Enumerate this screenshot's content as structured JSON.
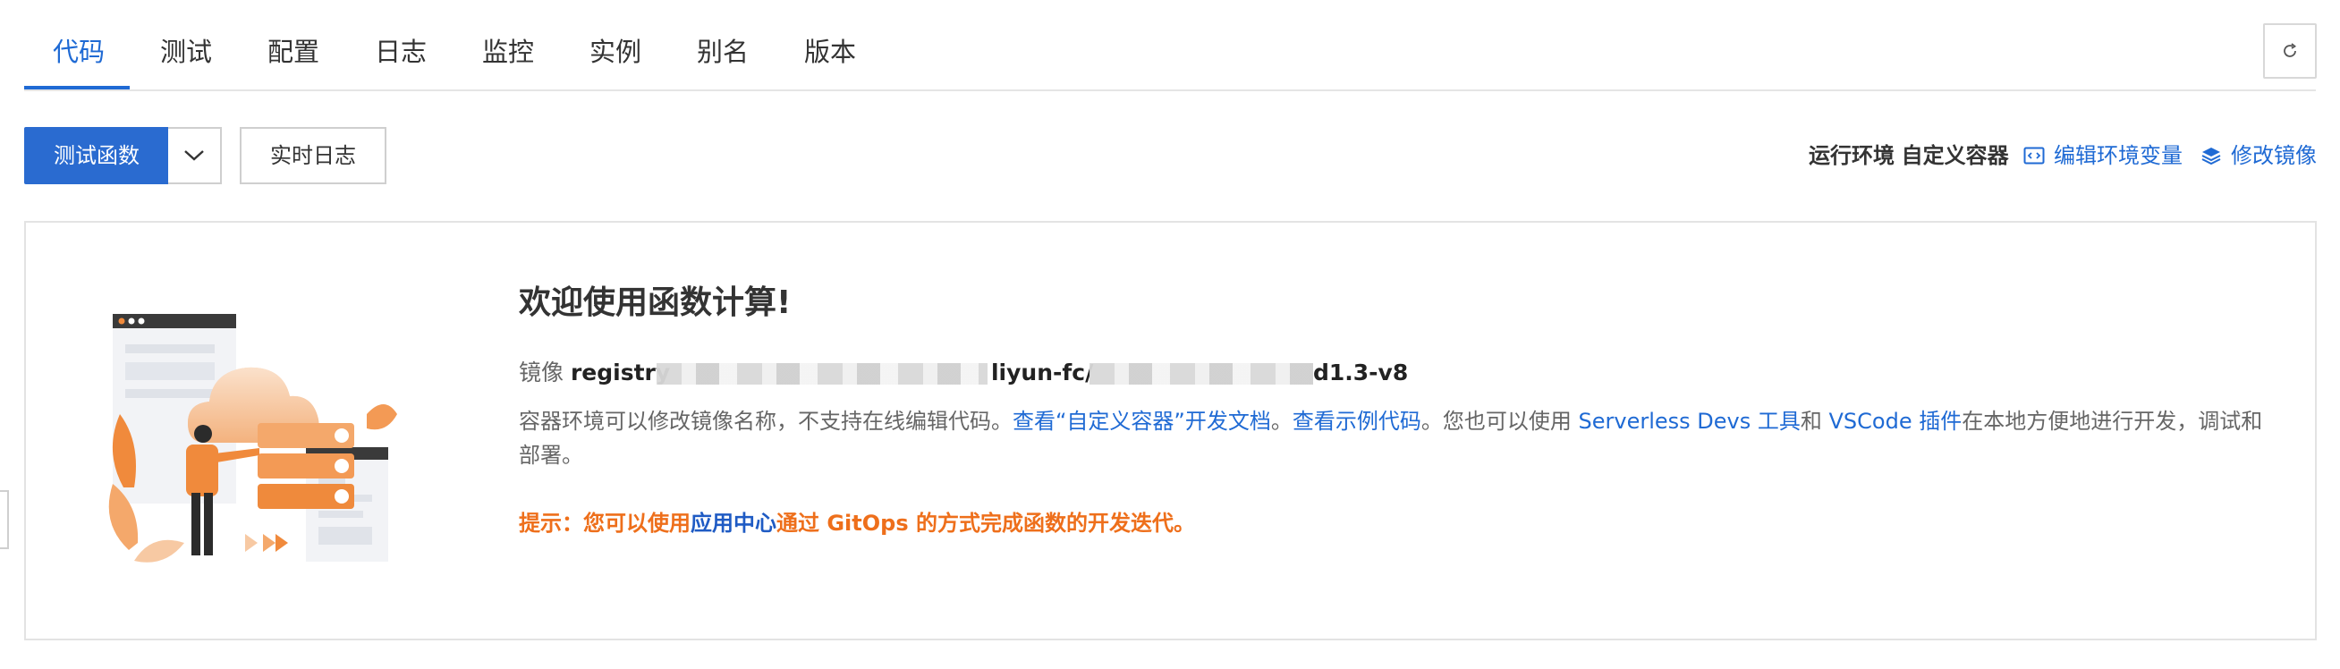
{
  "tabs": [
    {
      "label": "代码",
      "active": true
    },
    {
      "label": "测试",
      "active": false
    },
    {
      "label": "配置",
      "active": false
    },
    {
      "label": "日志",
      "active": false
    },
    {
      "label": "监控",
      "active": false
    },
    {
      "label": "实例",
      "active": false
    },
    {
      "label": "别名",
      "active": false
    },
    {
      "label": "版本",
      "active": false
    }
  ],
  "toolbar": {
    "test_button": "测试函数",
    "realtime_log_button": "实时日志",
    "runtime_label": "运行环境",
    "runtime_value": "自定义容器",
    "edit_env_link": "编辑环境变量",
    "modify_image_link": "修改镜像",
    "refresh_icon": "refresh-icon"
  },
  "welcome": {
    "title": "欢迎使用函数计算!",
    "image_label": "镜像",
    "image_prefix": "registry",
    "image_middle": "liyun-fc/",
    "image_suffix": "d1.3-v8",
    "desc_part1": "容器环境可以修改镜像名称，不支持在线编辑代码。",
    "desc_link1": "查看“自定义容器”开发文档",
    "desc_sep1": "。",
    "desc_link2": "查看示例代码",
    "desc_part2": "。您也可以使用 ",
    "desc_link3": "Serverless Devs 工具",
    "desc_part3": "和 ",
    "desc_link4": "VSCode 插件",
    "desc_part4": "在本地方便地进行开发，调试和部署。",
    "tip_prefix": "提示：您可以使用",
    "tip_link": "应用中心",
    "tip_suffix": "通过 GitOps 的方式完成函数的开发迭代。"
  },
  "colors": {
    "accent": "#1f6ad4",
    "primary_button": "#2a6bd0",
    "tip": "#ee6f1b",
    "illustration_orange": "#f08a3c"
  }
}
